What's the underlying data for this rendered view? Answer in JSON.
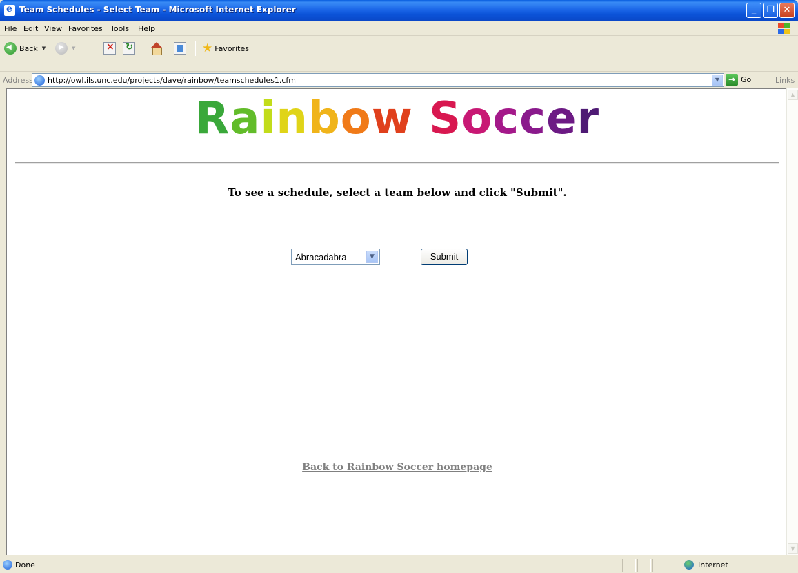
{
  "window": {
    "title": "Team Schedules - Select Team - Microsoft Internet Explorer",
    "minimize_glyph": "_",
    "maximize_glyph": "❐",
    "close_glyph": "✕"
  },
  "menu": {
    "file": "File",
    "edit": "Edit",
    "view": "View",
    "favorites": "Favorites",
    "tools": "Tools",
    "help": "Help"
  },
  "toolbar": {
    "back_label": "Back",
    "favorites_label": "Favorites"
  },
  "address": {
    "label": "Address",
    "url": "http://owl.ils.unc.edu/projects/dave/rainbow/teamschedules1.cfm",
    "go_label": "Go",
    "links_label": "Links"
  },
  "page": {
    "logo_letters": [
      {
        "ch": "R",
        "color": "#3aa83a"
      },
      {
        "ch": "a",
        "color": "#62bc2a"
      },
      {
        "ch": "i",
        "color": "#c2dc1a"
      },
      {
        "ch": "n",
        "color": "#e0d418"
      },
      {
        "ch": "b",
        "color": "#f0b41a"
      },
      {
        "ch": "o",
        "color": "#f07a18"
      },
      {
        "ch": "w",
        "color": "#e0401c"
      },
      {
        "ch": " ",
        "color": "#ffffff"
      },
      {
        "ch": "S",
        "color": "#d81850"
      },
      {
        "ch": "o",
        "color": "#c81874"
      },
      {
        "ch": "c",
        "color": "#a4198a"
      },
      {
        "ch": "c",
        "color": "#8a1a8c"
      },
      {
        "ch": "e",
        "color": "#6c1a84"
      },
      {
        "ch": "r",
        "color": "#4e1a74"
      }
    ],
    "instruction": "To see a schedule, select a team below and click \"Submit\".",
    "team_select_value": "Abracadabra",
    "submit_label": "Submit",
    "back_link": "Back to Rainbow Soccer homepage"
  },
  "status": {
    "text": "Done",
    "zone": "Internet"
  }
}
